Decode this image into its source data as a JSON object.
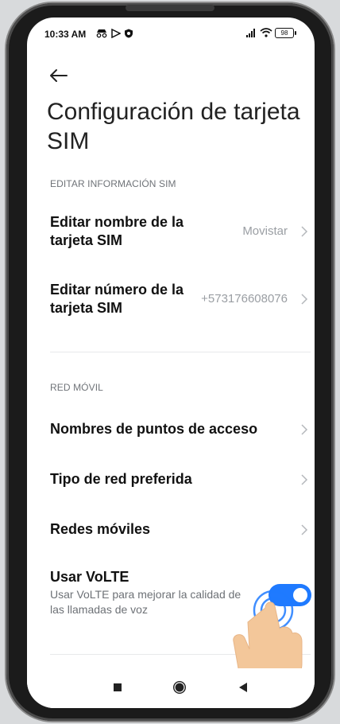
{
  "status_bar": {
    "time": "10:33 AM",
    "battery": "98"
  },
  "header": {
    "title": "Configuración de tarjeta SIM"
  },
  "sections": {
    "sim_info": {
      "header": "EDITAR INFORMACIÓN SIM",
      "items": [
        {
          "label": "Editar nombre de la tarjeta SIM",
          "value": "Movistar"
        },
        {
          "label": "Editar número de la tarjeta SIM",
          "value": "+573176608076"
        }
      ]
    },
    "mobile_network": {
      "header": "RED MÓVIL",
      "items": [
        {
          "label": "Nombres de puntos de acceso"
        },
        {
          "label": "Tipo de red preferida"
        },
        {
          "label": "Redes móviles"
        }
      ],
      "volte": {
        "label": "Usar VoLTE",
        "description": "Usar VoLTE para mejorar la calidad de las llamadas de voz",
        "enabled": true
      }
    }
  },
  "colors": {
    "accent": "#1f7aff",
    "hand": "#f3c79a",
    "ripple": "#1f7aff"
  },
  "icons": {
    "back": "arrow-left-icon",
    "chevron": "chevron-right-icon",
    "nav_recent": "square-icon",
    "nav_home": "circle-icon",
    "nav_back": "triangle-left-icon"
  }
}
